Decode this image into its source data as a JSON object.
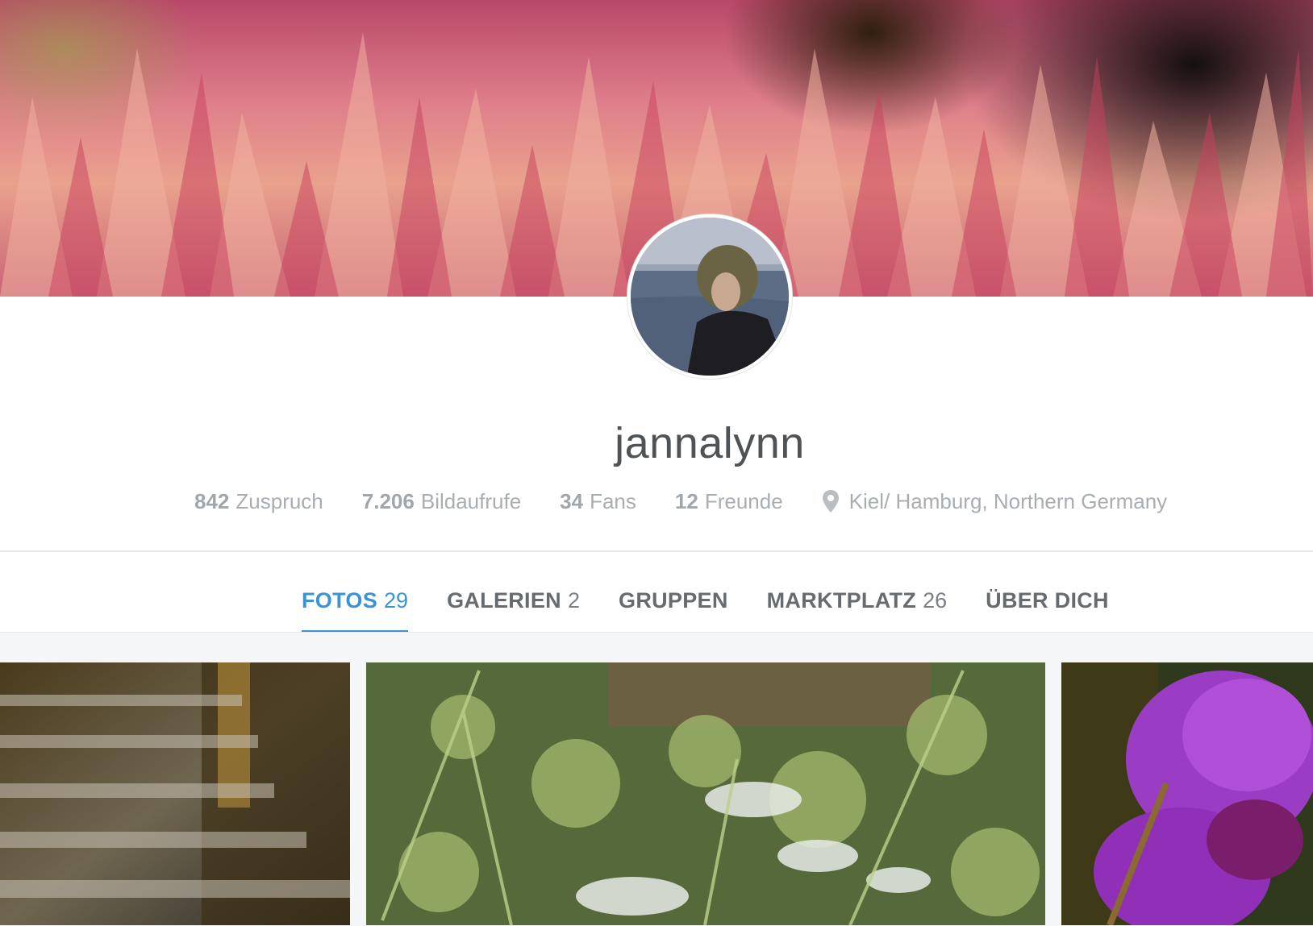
{
  "profile": {
    "username": "jannalynn",
    "stats": [
      {
        "value": "842",
        "label": "Zuspruch"
      },
      {
        "value": "7.206",
        "label": "Bildaufrufe"
      },
      {
        "value": "34",
        "label": "Fans"
      },
      {
        "value": "12",
        "label": "Freunde"
      }
    ],
    "location": "Kiel/ Hamburg, Northern Germany",
    "location_icon": "map-pin-icon"
  },
  "tabs": [
    {
      "label": "FOTOS",
      "count": "29",
      "active": true
    },
    {
      "label": "GALERIEN",
      "count": "2",
      "active": false
    },
    {
      "label": "GRUPPEN",
      "count": "",
      "active": false
    },
    {
      "label": "MARKTPLATZ",
      "count": "26",
      "active": false
    },
    {
      "label": "ÜBER DICH",
      "count": "",
      "active": false
    }
  ],
  "colors": {
    "accent": "#3a94d4",
    "text_dark": "#4f5356",
    "text_muted": "#a8adb2",
    "grid_background": "#f4f6f8"
  }
}
